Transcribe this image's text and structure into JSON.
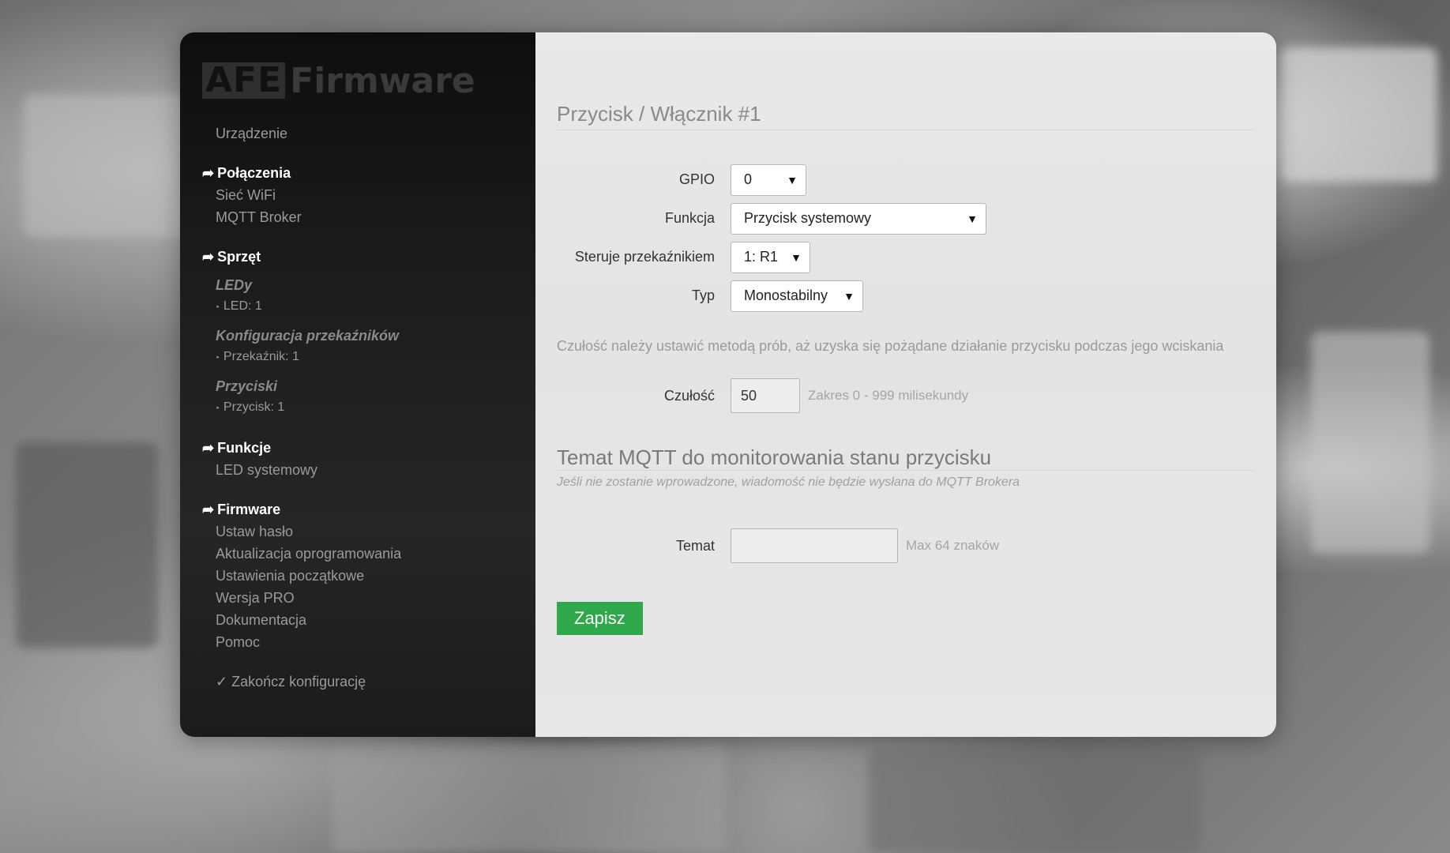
{
  "brand": {
    "logo_box": "AFE",
    "logo_text": "Firmware"
  },
  "sidebar": {
    "device": "Urządzenie",
    "connections_head": "Połączenia",
    "wifi": "Sieć WiFi",
    "mqtt": "MQTT Broker",
    "hardware_head": "Sprzęt",
    "leds_sub": "LEDy",
    "led_item": "LED: 1",
    "relays_sub": "Konfiguracja przekaźników",
    "relay_item": "Przekaźnik: 1",
    "buttons_sub": "Przyciski",
    "button_item": "Przycisk: 1",
    "functions_head": "Funkcje",
    "system_led": "LED systemowy",
    "firmware_head": "Firmware",
    "set_password": "Ustaw hasło",
    "update": "Aktualizacja oprogramowania",
    "reset": "Ustawienia początkowe",
    "pro": "Wersja PRO",
    "docs": "Dokumentacja",
    "help": "Pomoc",
    "finish": "✓ Zakończ konfigurację",
    "arrow": "➦",
    "tri": "‣"
  },
  "form": {
    "title": "Przycisk / Włącznik #1",
    "gpio_label": "GPIO",
    "gpio_value": "0",
    "function_label": "Funkcja",
    "function_value": "Przycisk systemowy",
    "relay_label": "Steruje przekaźnikiem",
    "relay_value": "1: R1",
    "type_label": "Typ",
    "type_value": "Monostabilny",
    "sensitivity_desc": "Czułość należy ustawić metodą prób, aż uzyska się pożądane działanie przycisku podczas jego wciskania",
    "sensitivity_label": "Czułość",
    "sensitivity_value": "50",
    "sensitivity_hint": "Zakres 0 - 999 milisekundy",
    "mqtt_title": "Temat MQTT do monitorowania stanu przycisku",
    "mqtt_note": "Jeśli nie zostanie wprowadzone, wiadomość nie będzie wysłana do MQTT Brokera",
    "topic_label": "Temat",
    "topic_value": "",
    "topic_hint": "Max 64 znaków",
    "save": "Zapisz"
  },
  "colors": {
    "save_green": "#2ea84a",
    "sidebar_bg": "#1c1c1c",
    "main_bg": "#e7e7e7"
  },
  "icons": {
    "caret": "chevron-down-icon",
    "arrow": "arrow-right-icon",
    "check": "check-icon"
  }
}
